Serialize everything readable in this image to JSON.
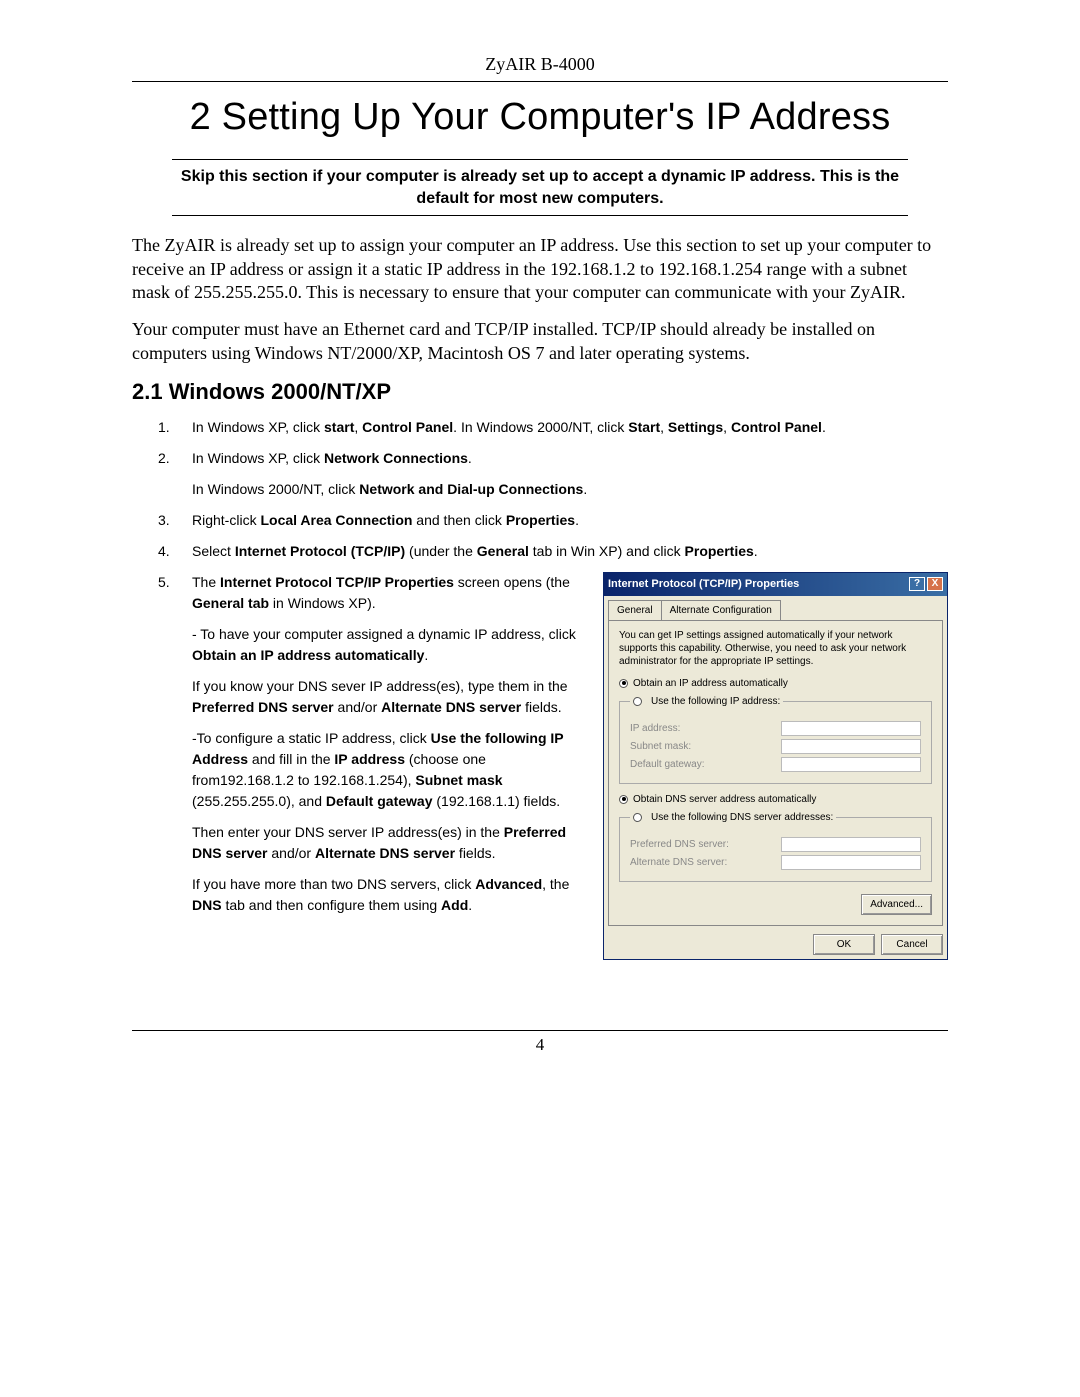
{
  "header": {
    "product": "ZyAIR B-4000"
  },
  "chapter": {
    "title": "2 Setting Up Your Computer's IP Address"
  },
  "skip_note": "Skip this section if your computer is already set up to accept a dynamic IP address. This is the default for most new computers.",
  "para1": "The ZyAIR is already set up to assign your computer an IP address. Use this section to set up your computer to receive an IP address or assign it a static IP address in the 192.168.1.2 to 192.168.1.254 range with a subnet mask of 255.255.255.0. This is necessary to ensure that your computer can communicate with your ZyAIR.",
  "para2": "Your computer must have an Ethernet card and TCP/IP installed. TCP/IP should already be installed on computers using Windows NT/2000/XP, Macintosh OS 7 and later operating systems.",
  "section": {
    "heading": "2.1 Windows 2000/NT/XP"
  },
  "steps": {
    "s1": {
      "num": "1.",
      "pre": "In Windows XP, click ",
      "b1": "start",
      "mid1": ", ",
      "b2": "Control Panel",
      "mid2": ". In Windows 2000/NT, click ",
      "b3": "Start",
      "mid3": ", ",
      "b4": "Settings",
      "mid4": ", ",
      "b5": "Control Panel",
      "post": "."
    },
    "s2": {
      "num": "2.",
      "l1_pre": "In Windows XP, click ",
      "l1_b": "Network Connections",
      "l1_post": ".",
      "l2_pre": "In Windows 2000/NT, click ",
      "l2_b": "Network and Dial-up Connections",
      "l2_post": "."
    },
    "s3": {
      "num": "3.",
      "pre": "Right-click ",
      "b1": "Local Area Connection",
      "mid": " and then click ",
      "b2": "Properties",
      "post": "."
    },
    "s4": {
      "num": "4.",
      "pre": "Select ",
      "b1": "Internet Protocol (TCP/IP)",
      "mid1": " (under the ",
      "b2": "General",
      "mid2": " tab in Win XP) and click ",
      "b3": "Properties",
      "post": "."
    },
    "s5": {
      "num": "5.",
      "p1_pre": "The ",
      "p1_b1": "Internet Protocol TCP/IP Properties",
      "p1_mid": " screen opens (the ",
      "p1_b2": "General tab",
      "p1_post": " in Windows XP).",
      "p2_pre": "- To have your computer assigned a dynamic IP address, click ",
      "p2_b": "Obtain an IP address automatically",
      "p2_post": ".",
      "p3_pre": "If you know your DNS sever IP address(es), type them in the ",
      "p3_b1": "Preferred DNS server",
      "p3_mid": " and/or ",
      "p3_b2": "Alternate DNS server",
      "p3_post": " fields.",
      "p4_pre": "-To configure a static IP address, click ",
      "p4_b1": "Use the following IP Address",
      "p4_mid1": " and fill in the ",
      "p4_b2": "IP address",
      "p4_mid2": " (choose one from192.168.1.2 to 192.168.1.254), ",
      "p4_b3": "Subnet mask",
      "p4_mid3": " (255.255.255.0), and ",
      "p4_b4": "Default gateway",
      "p4_post": " (192.168.1.1) fields.",
      "p5_pre": "Then enter your DNS server IP address(es) in the ",
      "p5_b1": "Preferred DNS server",
      "p5_mid": " and/or ",
      "p5_b2": "Alternate DNS server",
      "p5_post": " fields.",
      "p6_pre": "If you have more than two DNS servers, click ",
      "p6_b1": "Advanced",
      "p6_mid1": ", the ",
      "p6_b2": "DNS",
      "p6_mid2": " tab and then configure them using ",
      "p6_b3": "Add",
      "p6_post": "."
    }
  },
  "dialog": {
    "title": "Internet Protocol (TCP/IP) Properties",
    "help": "?",
    "close": "X",
    "tab1": "General",
    "tab2": "Alternate Configuration",
    "desc": "You can get IP settings assigned automatically if your network supports this capability. Otherwise, you need to ask your network administrator for the appropriate IP settings.",
    "r1": "Obtain an IP address automatically",
    "r2": "Use the following IP address:",
    "f_ip": "IP address:",
    "f_mask": "Subnet mask:",
    "f_gw": "Default gateway:",
    "r3": "Obtain DNS server address automatically",
    "r4": "Use the following DNS server addresses:",
    "f_pdns": "Preferred DNS server:",
    "f_adns": "Alternate DNS server:",
    "btn_adv": "Advanced...",
    "btn_ok": "OK",
    "btn_cancel": "Cancel"
  },
  "footer": {
    "page": "4"
  }
}
